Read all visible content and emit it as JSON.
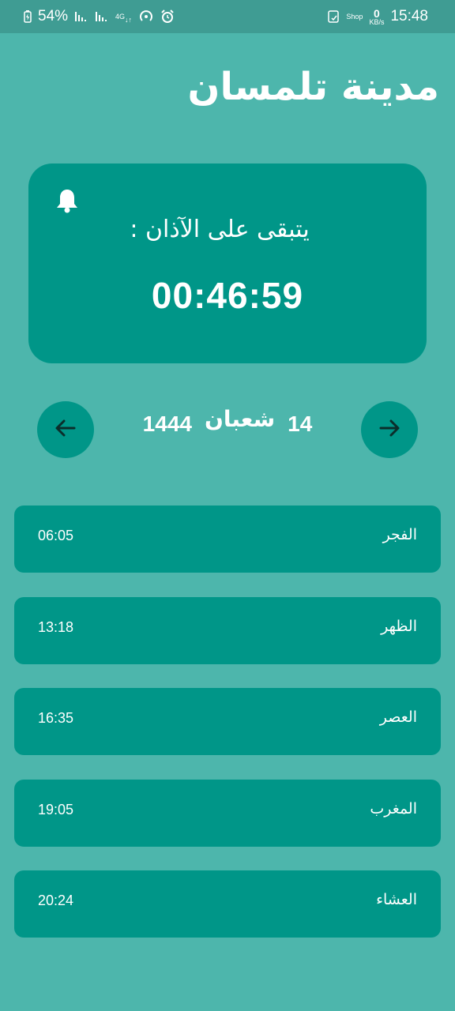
{
  "status_bar": {
    "battery": "54%",
    "network": "4G",
    "shop": "Shop",
    "speed_value": "0",
    "speed_unit": "KB/s",
    "time": "15:48"
  },
  "city": "مدينة تلمسان",
  "countdown": {
    "label": "يتبقى على الآذان :",
    "time": "00:46:59"
  },
  "hijri_date": {
    "day": "14",
    "month": "شعبان",
    "year": "1444"
  },
  "prayers": [
    {
      "name": "الفجر",
      "time": "06:05"
    },
    {
      "name": "الظهر",
      "time": "13:18"
    },
    {
      "name": "العصر",
      "time": "16:35"
    },
    {
      "name": "المغرب",
      "time": "19:05"
    },
    {
      "name": "العشاء",
      "time": "20:24"
    }
  ],
  "icons": {
    "bell": "bell-icon",
    "prev": "arrow-left-icon",
    "next": "arrow-right-icon"
  },
  "colors": {
    "background": "#4db6ac",
    "card": "#009688",
    "status_bar": "#3f9c93",
    "text": "#ffffff"
  }
}
